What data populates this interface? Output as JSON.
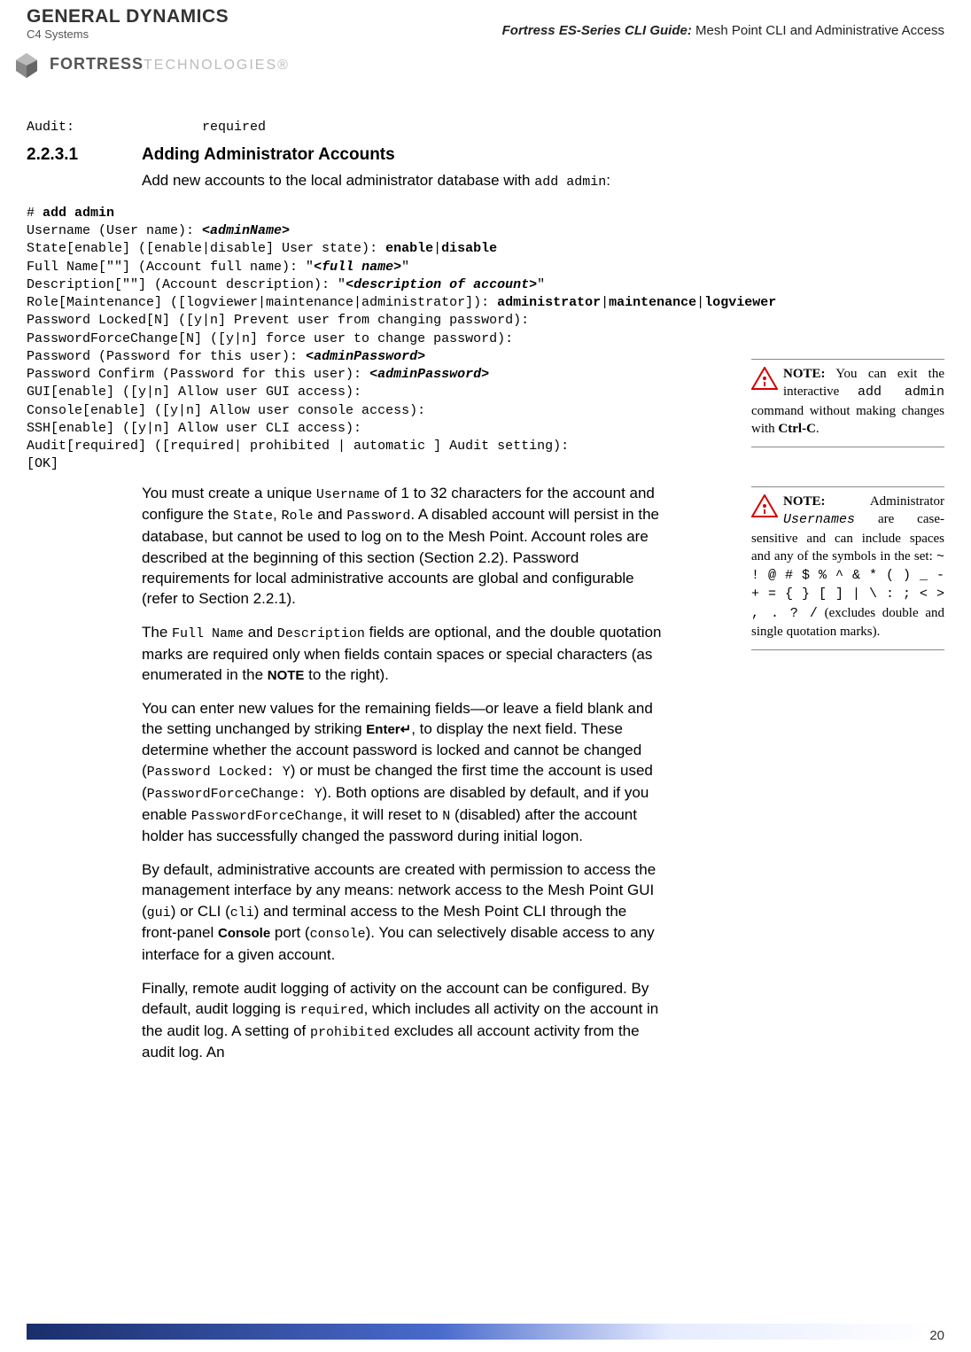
{
  "header": {
    "logo_main": "GENERAL DYNAMICS",
    "logo_sub": "C4 Systems",
    "fortress_brand": "FORTRESS",
    "fortress_tail": "TECHNOLOGIES®",
    "guide_title_bold": "Fortress ES-Series CLI Guide:",
    "guide_title_rest": " Mesh Point CLI and Administrative Access"
  },
  "frag_line": "Audit:                required",
  "section": {
    "number": "2.2.3.1",
    "title": "Adding Administrator Accounts",
    "intro_a": "Add new accounts to the local administrator database with ",
    "intro_code": "add admin",
    "intro_b": ":"
  },
  "code": {
    "l01a": "# ",
    "l01b": "add admin",
    "l02a": "Username (User name): ",
    "l02b": "<adminName>",
    "l03a": "State[enable] ([enable|disable] User state): ",
    "l03b": "enable",
    "l03c": "|",
    "l03d": "disable",
    "l04a": "Full Name[\"\"] (Account full name): \"",
    "l04b": "<full name>",
    "l04c": "\"",
    "l05a": "Description[\"\"] (Account description): \"",
    "l05b": "<description of account>",
    "l05c": "\"",
    "l06a": "Role[Maintenance] ([logviewer|maintenance|administrator]): ",
    "l06b": "administrator",
    "l06c": "|",
    "l06d": "maintenance",
    "l06e": "|",
    "l06f": "logviewer",
    "l07": "Password Locked[N] ([y|n] Prevent user from changing password):",
    "l08": "PasswordForceChange[N] ([y|n] force user to change password):",
    "l09a": "Password (Password for this user): ",
    "l09b": "<adminPassword>",
    "l10a": "Password Confirm (Password for this user): ",
    "l10b": "<adminPassword>",
    "l11": "GUI[enable] ([y|n] Allow user GUI access):",
    "l12": "Console[enable] ([y|n] Allow user console access):",
    "l13": "SSH[enable] ([y|n] Allow user CLI access):",
    "l14": "Audit[required] ([required| prohibited | automatic ] Audit setting):",
    "l15": "[OK]"
  },
  "para1": {
    "t1": "You must create a unique ",
    "c1": "Username",
    "t2": " of 1 to 32 characters for the account and configure the ",
    "c2": "State",
    "t3": ", ",
    "c3": "Role",
    "t4": " and ",
    "c4": "Password",
    "t5": ". A disabled account will persist in the database, but cannot be used to log on to the Mesh Point. Account roles are described at the beginning of this section (Section 2.2). Password requirements for local administrative accounts are global and configurable (refer to Section 2.2.1)."
  },
  "para2": {
    "t1": "The ",
    "c1": "Full Name",
    "t2": " and ",
    "c2": "Description",
    "t3": " fields are optional, and the double quotation marks are required only when fields contain spaces or special characters (as enumerated in the ",
    "b1": "NOTE",
    "t4": " to the right)."
  },
  "para3": {
    "t1": "You can enter new values for the remaining fields—or leave a field blank and the setting unchanged by striking ",
    "b1": "Enter↵",
    "t2": ", to display the next field. These determine whether the account password is locked and cannot be changed (",
    "c1": "Password Locked: Y",
    "t3": ") or must be changed the first time the account is used (",
    "c2": "PasswordForceChange: Y",
    "t4": "). Both options are disabled by default, and if you enable ",
    "c3": "PasswordForceChange",
    "t5": ", it will reset to ",
    "c4": "N",
    "t6": " (disabled) after the account holder has successfully changed the password during initial logon."
  },
  "para4": {
    "t1": "By default, administrative accounts are created with permission to access the management interface by any means: network access to the Mesh Point GUI (",
    "c1": "gui",
    "t2": ") or CLI (",
    "c2": "cli",
    "t3": ") and terminal access to the Mesh Point CLI through the front-panel ",
    "b1": "Console",
    "t4": " port (",
    "c3": "console",
    "t5": "). You can selectively disable access to any interface for a given account."
  },
  "para5": {
    "t1": "Finally, remote audit logging of activity on the account can be configured. By default, audit logging is ",
    "c1": "required",
    "t2": ", which includes all activity on the account in the audit log. A setting of ",
    "c2": "prohibited",
    "t3": " excludes all account activity from the audit log. An"
  },
  "note1": {
    "label": "NOTE:",
    "t1": " You can exit the interactive ",
    "c1": "add admin",
    "t2": " command without making changes with ",
    "b1": "Ctrl-C",
    "t3": "."
  },
  "note2": {
    "label": "NOTE:",
    "t1": " Administrator ",
    "ci": "Usernames",
    "t2": " are case-sensitive and can include spaces and any of the symbols in the set: ",
    "sym": "~ ! @ # $ % ^ & * ( ) _ - + = { } [ ] | \\ : ; < > , . ? /",
    "t3": " (excludes double and single quotation marks)."
  },
  "page_number": "20"
}
